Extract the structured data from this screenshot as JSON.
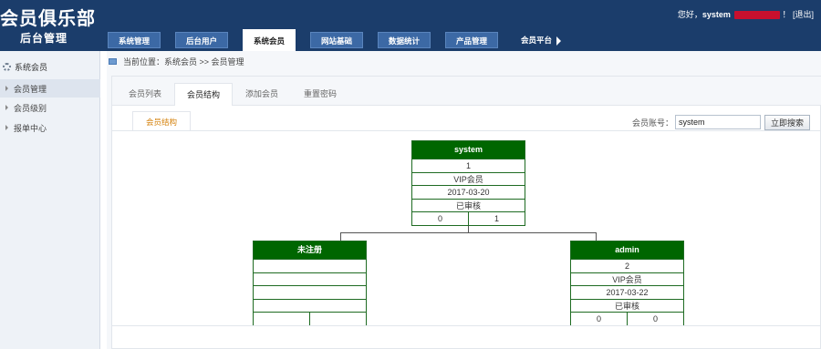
{
  "header": {
    "brand": "会员俱乐部",
    "subtitle": "后台管理",
    "greeting_prefix": "您好，",
    "username": "system",
    "role": "超级管理员",
    "exclaim": "！",
    "logout": "[退出]",
    "nav": [
      {
        "label": "系统管理"
      },
      {
        "label": "后台用户"
      },
      {
        "label": "系统会员"
      },
      {
        "label": "网站基础"
      },
      {
        "label": "数据统计"
      },
      {
        "label": "产品管理"
      },
      {
        "label": "会员平台"
      }
    ]
  },
  "sidebar": {
    "title": "系统会员",
    "items": [
      {
        "label": "会员管理"
      },
      {
        "label": "会员级别"
      },
      {
        "label": "报单中心"
      }
    ]
  },
  "breadcrumb": "当前位置：系统会员 >> 会员管理",
  "tabs": [
    {
      "label": "会员列表"
    },
    {
      "label": "会员结构"
    },
    {
      "label": "添加会员"
    },
    {
      "label": "重置密码"
    }
  ],
  "subtab": "会员结构",
  "search": {
    "label": "会员账号：",
    "value": "system",
    "button": "立即搜索"
  },
  "tree": {
    "root": {
      "name": "system",
      "id": "1",
      "level": "VIP会员",
      "date": "2017-03-20",
      "status": "已审核",
      "left": "0",
      "right": "1"
    },
    "left_child": {
      "name": "未注册",
      "id": "",
      "level": "",
      "date": "",
      "status": "",
      "left": "",
      "right": ""
    },
    "right_child": {
      "name": "admin",
      "id": "2",
      "level": "VIP会员",
      "date": "2017-03-22",
      "status": "已审核",
      "left": "0",
      "right": "0"
    }
  },
  "colors": {
    "header_bg": "#1b3d6b",
    "nav_tab_bg": "#3c69a5",
    "node_header_bg": "#006600",
    "subtab_text": "#d4800a"
  }
}
